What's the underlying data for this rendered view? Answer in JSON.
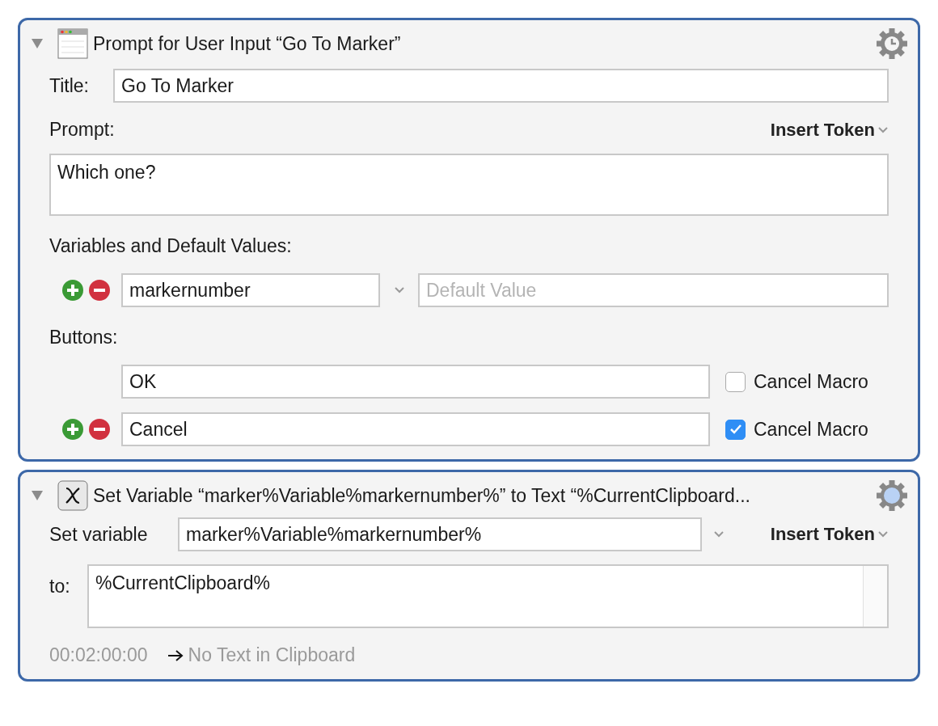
{
  "actions": [
    {
      "kind": "prompt",
      "expanded": true,
      "title": "Prompt for User Input “Go To Marker”",
      "title_label": "Title:",
      "title_value": "Go To Marker",
      "prompt_label": "Prompt:",
      "insert_token": "Insert Token",
      "prompt_value": "Which one?",
      "variables_label": "Variables and Default Values:",
      "variables": [
        {
          "name": "markernumber",
          "default_placeholder": "Default Value"
        }
      ],
      "buttons_label": "Buttons:",
      "buttons": [
        {
          "name": "OK",
          "cancel_label": "Cancel Macro",
          "cancel_checked": false,
          "removable": false
        },
        {
          "name": "Cancel",
          "cancel_label": "Cancel Macro",
          "cancel_checked": true,
          "removable": true
        }
      ]
    },
    {
      "kind": "set_variable",
      "expanded": true,
      "title": "Set Variable “marker%Variable%markernumber%” to Text “%CurrentClipboard...",
      "variable_label": "Set variable",
      "variable_value": "marker%Variable%markernumber%",
      "insert_token": "Insert Token",
      "to_label": "to:",
      "to_value": "%CurrentClipboard%",
      "time": "00:02:00:00",
      "result": "No Text in Clipboard"
    }
  ]
}
